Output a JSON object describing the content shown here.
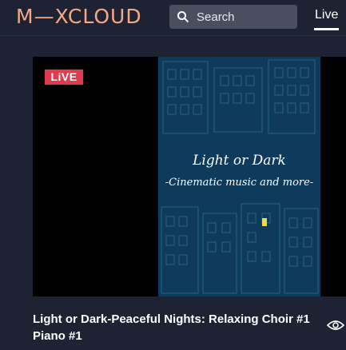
{
  "header": {
    "logo": "M—XCLOUD",
    "search_placeholder": "Search",
    "nav_live": "Live"
  },
  "player": {
    "badge": "LiVE",
    "cover_title": "Light or Dark",
    "cover_subtitle": "-Cinematic music and more-"
  },
  "stream": {
    "title": "Light or Dark-Peaceful Nights: Relaxing Choir #1 Piano #1"
  },
  "colors": {
    "background": "#1e2334",
    "logo": "#f5a886",
    "live_badge": "#e03a4e",
    "cover_bg": "#0e3a5c"
  }
}
